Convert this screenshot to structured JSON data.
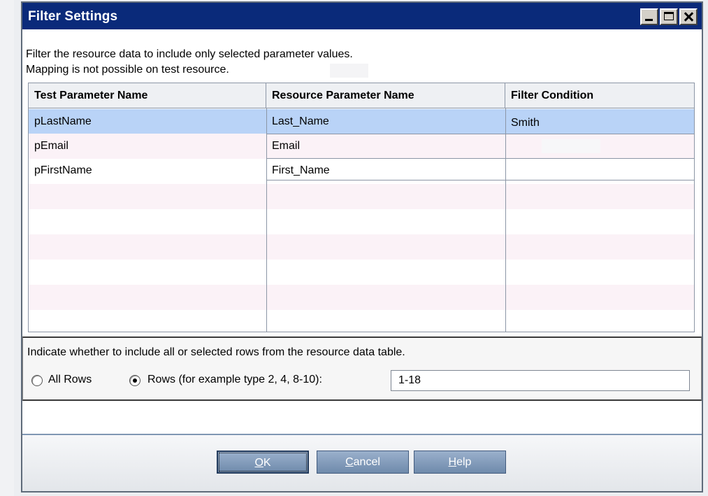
{
  "dialog": {
    "title": "Filter Settings",
    "description_line1": "Filter the resource data to include only selected parameter values.",
    "description_line2": "Mapping is not possible on test resource."
  },
  "grid": {
    "columns": [
      "Test Parameter Name",
      "Resource Parameter Name",
      "Filter Condition"
    ],
    "rows": [
      {
        "test": "pLastName",
        "resource": "Last_Name",
        "filter": "Smith",
        "selected": true
      },
      {
        "test": "pEmail",
        "resource": "Email",
        "filter": ""
      },
      {
        "test": "pFirstName",
        "resource": "First_Name",
        "filter": ""
      }
    ]
  },
  "rows_panel": {
    "hint": "Indicate whether to include all or selected rows from the resource data table.",
    "all_rows_label": "All Rows",
    "rows_label": "Rows (for example type 2, 4, 8-10):",
    "rows_value": "1-18",
    "selected_option": "rows"
  },
  "buttons": {
    "ok_mnemonic": "O",
    "ok_rest": "K",
    "cancel_mnemonic": "C",
    "cancel_rest": "ancel",
    "help_mnemonic": "H",
    "help_rest": "elp"
  },
  "colors": {
    "titlebar": "#0a2a7a",
    "selected_row": "#b9d3f7",
    "button": "#7f98b8"
  }
}
